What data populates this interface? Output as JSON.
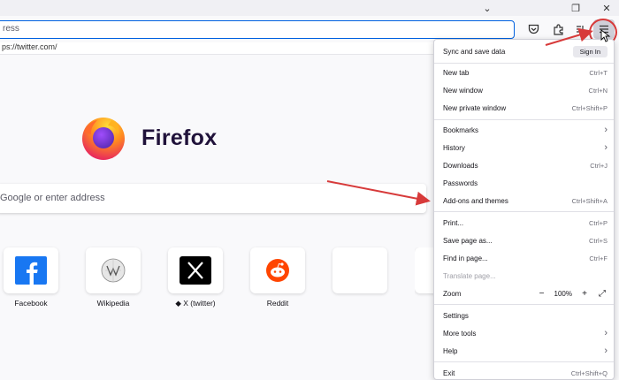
{
  "window": {
    "controls": {
      "dropdown": "⌄",
      "restore": "❐",
      "close": "✕"
    }
  },
  "toolbar": {
    "url_value": "ress",
    "suggestion": "ps://twitter.com/",
    "icons": [
      "pocket-icon",
      "extensions-icon",
      "bookmarks-list-icon",
      "hamburger-menu-icon"
    ]
  },
  "newtab": {
    "brand": "Firefox",
    "search_placeholder": "Google or enter address",
    "tiles": [
      {
        "label": "Facebook",
        "icon": "facebook-icon"
      },
      {
        "label": "Wikipedia",
        "icon": "wikipedia-icon"
      },
      {
        "label": "◆ X (twitter)",
        "icon": "x-icon"
      },
      {
        "label": "Reddit",
        "icon": "reddit-icon"
      },
      {
        "label": "",
        "icon": ""
      },
      {
        "label": "",
        "icon": ""
      }
    ]
  },
  "menu": {
    "sync": {
      "label": "Sync and save data",
      "button": "Sign In"
    },
    "new_tab": {
      "label": "New tab",
      "shortcut": "Ctrl+T"
    },
    "new_window": {
      "label": "New window",
      "shortcut": "Ctrl+N"
    },
    "new_private": {
      "label": "New private window",
      "shortcut": "Ctrl+Shift+P"
    },
    "bookmarks": {
      "label": "Bookmarks"
    },
    "history": {
      "label": "History"
    },
    "downloads": {
      "label": "Downloads",
      "shortcut": "Ctrl+J"
    },
    "passwords": {
      "label": "Passwords"
    },
    "addons": {
      "label": "Add-ons and themes",
      "shortcut": "Ctrl+Shift+A"
    },
    "print": {
      "label": "Print...",
      "shortcut": "Ctrl+P"
    },
    "save_page": {
      "label": "Save page as...",
      "shortcut": "Ctrl+S"
    },
    "find": {
      "label": "Find in page...",
      "shortcut": "Ctrl+F"
    },
    "translate": {
      "label": "Translate page..."
    },
    "zoom": {
      "label": "Zoom",
      "minus": "−",
      "value": "100%",
      "plus": "+",
      "fullscreen": "⤢"
    },
    "settings": {
      "label": "Settings"
    },
    "more_tools": {
      "label": "More tools"
    },
    "help": {
      "label": "Help"
    },
    "exit": {
      "label": "Exit",
      "shortcut": "Ctrl+Shift+Q"
    },
    "chevron": "›"
  },
  "colors": {
    "accent": "#0061e0",
    "annotation_red": "#d73a3a",
    "firefox_purple": "#20123a"
  }
}
